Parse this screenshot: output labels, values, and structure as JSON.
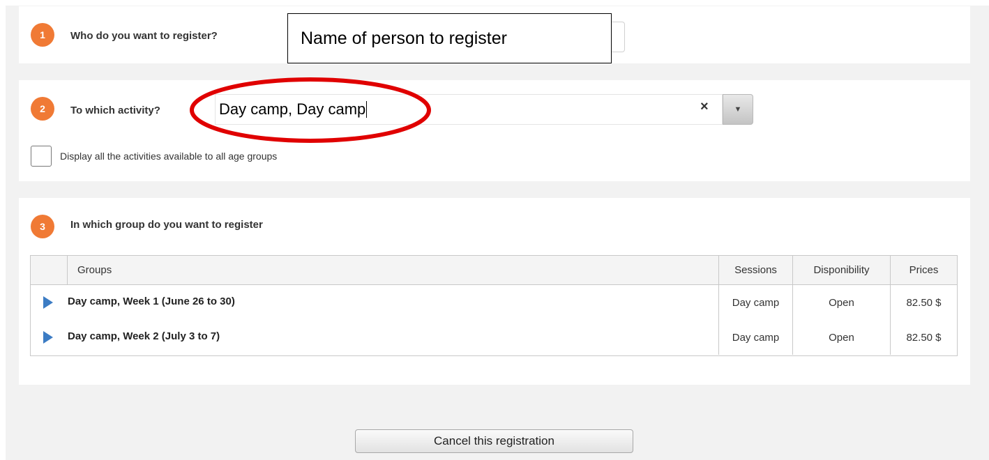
{
  "step1": {
    "number": "1",
    "label": "Who do you want to register?",
    "name_value": "Name of person to register"
  },
  "step2": {
    "number": "2",
    "label": "To which activity?",
    "activity_value": "Day camp, Day camp",
    "clear_symbol": "×",
    "dropdown_symbol": "▼",
    "checkbox_label": "Display all the activities available to all age groups",
    "checkbox_checked": false
  },
  "step3": {
    "number": "3",
    "label": "In which group do you want to register",
    "columns": [
      "Groups",
      "Sessions",
      "Disponibility",
      "Prices"
    ],
    "rows": [
      {
        "group": "Day camp, Week 1 (June 26 to 30)",
        "session": "Day camp",
        "availability": "Open",
        "price": "82.50 $"
      },
      {
        "group": "Day camp, Week 2 (July 3 to 7)",
        "session": "Day camp",
        "availability": "Open",
        "price": "82.50 $"
      }
    ]
  },
  "footer": {
    "cancel_label": "Cancel this registration"
  },
  "colors": {
    "step_badge": "#f07a35",
    "highlight_ellipse": "#e00000",
    "expand_arrow": "#3c7cc4"
  },
  "icons": {
    "clear": "close-icon",
    "dropdown": "chevron-down-icon",
    "expand": "triangle-right-icon"
  }
}
